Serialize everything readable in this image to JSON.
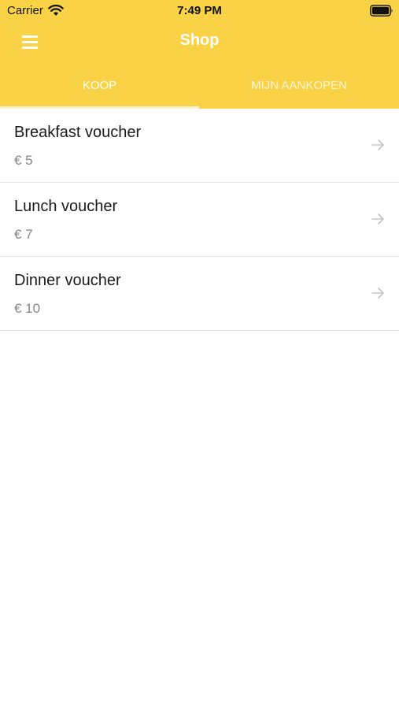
{
  "status_bar": {
    "carrier": "Carrier",
    "time": "7:49 PM"
  },
  "nav": {
    "title": "Shop",
    "menu_icon": "hamburger-menu-icon"
  },
  "tabs": [
    {
      "label": "KOOP",
      "active": true
    },
    {
      "label": "MIJN AANKOPEN",
      "active": false
    }
  ],
  "vouchers": [
    {
      "name": "Breakfast voucher",
      "price": "€ 5"
    },
    {
      "name": "Lunch voucher",
      "price": "€ 7"
    },
    {
      "name": "Dinner voucher",
      "price": "€ 10"
    }
  ],
  "colors": {
    "accent": "#f9d246",
    "text": "#1a1a1a",
    "price": "#858585",
    "divider": "#e4e4e4"
  }
}
